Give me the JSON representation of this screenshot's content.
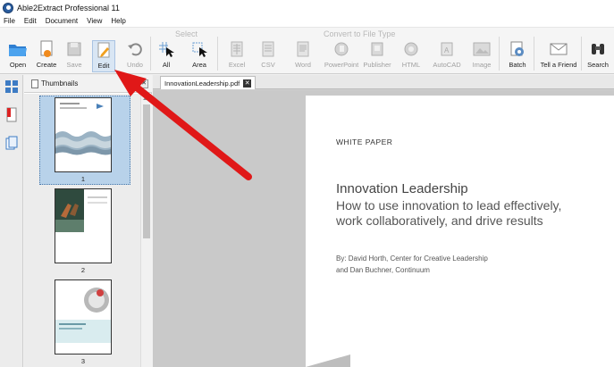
{
  "window": {
    "title": "Able2Extract Professional 11"
  },
  "menu": [
    "File",
    "Edit",
    "Document",
    "View",
    "Help"
  ],
  "ribbon": {
    "groups": {
      "select": "Select",
      "convert": "Convert to File Type"
    },
    "tools": {
      "open": "Open",
      "create": "Create",
      "save": "Save",
      "edit": "Edit",
      "undo": "Undo",
      "all": "All",
      "area": "Area",
      "excel": "Excel",
      "csv": "CSV",
      "word": "Word",
      "powerpoint": "PowerPoint",
      "publisher": "Publisher",
      "html": "HTML",
      "autocad": "AutoCAD",
      "image": "Image",
      "batch": "Batch",
      "tell_friend": "Tell a Friend",
      "search": "Search"
    }
  },
  "thumbnails": {
    "header": "Thumbnails",
    "pages": [
      "1",
      "2",
      "3"
    ]
  },
  "document": {
    "tab": "InnovationLeadership.pdf",
    "label": "WHITE PAPER",
    "title": "Innovation Leadership",
    "subtitle_line1": "How to use innovation to lead effectively,",
    "subtitle_line2": "work collaboratively, and drive results",
    "byline1": "By: David Horth, Center for Creative Leadership",
    "byline2": "and Dan Buchner, Continuum"
  },
  "colors": {
    "annotation_arrow": "#e01818",
    "accent": "#2a5d9f",
    "selection": "#b8d2ea"
  }
}
